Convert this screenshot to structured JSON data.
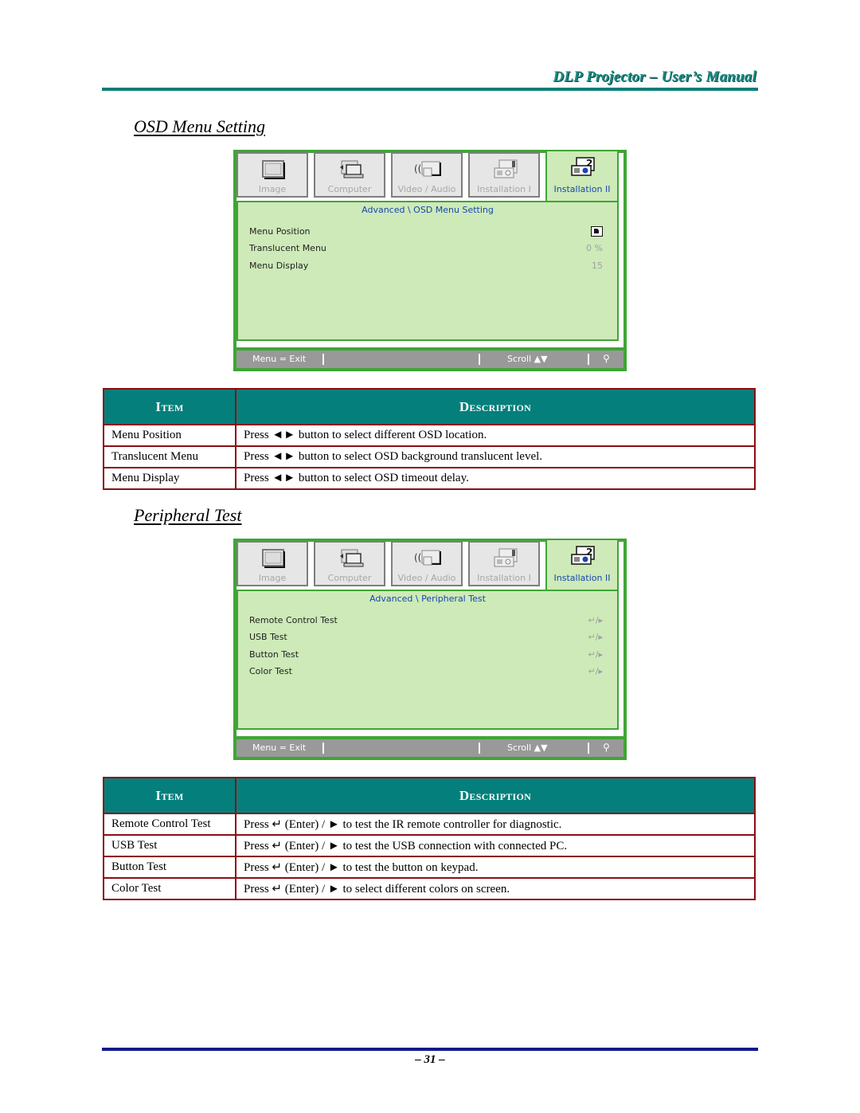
{
  "header": {
    "title": "DLP Projector – User’s Manual"
  },
  "sections": [
    {
      "title": "OSD Menu Setting",
      "osd": {
        "tabs": [
          {
            "label": "Image",
            "icon": "image-icon"
          },
          {
            "label": "Computer",
            "icon": "computer-icon"
          },
          {
            "label": "Video / Audio",
            "icon": "video-audio-icon"
          },
          {
            "label": "Installation I",
            "icon": "installation-1-icon"
          },
          {
            "label": "Installation II",
            "icon": "installation-2-icon",
            "active": true
          }
        ],
        "breadcrumb": "Advanced \\ OSD Menu Setting",
        "items": [
          {
            "label": "Menu Position",
            "value": "",
            "value_icon": "position-icon"
          },
          {
            "label": "Translucent Menu",
            "value": "0 %"
          },
          {
            "label": "Menu Display",
            "value": "15"
          }
        ],
        "footer": {
          "exit": "Menu = Exit",
          "scroll": "Scroll ▲▼",
          "bulb": "lamp-icon"
        }
      },
      "table": {
        "headers": [
          "Item",
          "Description"
        ],
        "rows": [
          [
            "Menu Position",
            "Press ◄► button to select different OSD location."
          ],
          [
            "Translucent Menu",
            "Press ◄► button to select OSD background translucent level."
          ],
          [
            "Menu Display",
            "Press ◄► button to select OSD timeout delay."
          ]
        ]
      }
    },
    {
      "title": "Peripheral Test",
      "osd": {
        "tabs": [
          {
            "label": "Image",
            "icon": "image-icon"
          },
          {
            "label": "Computer",
            "icon": "computer-icon"
          },
          {
            "label": "Video / Audio",
            "icon": "video-audio-icon"
          },
          {
            "label": "Installation I",
            "icon": "installation-1-icon"
          },
          {
            "label": "Installation II",
            "icon": "installation-2-icon",
            "active": true
          }
        ],
        "breadcrumb": "Advanced \\ Peripheral Test",
        "items": [
          {
            "label": "Remote Control Test",
            "value": "↵/▸"
          },
          {
            "label": "USB Test",
            "value": "↵/▸"
          },
          {
            "label": "Button Test",
            "value": "↵/▸"
          },
          {
            "label": "Color Test",
            "value": "↵/▸"
          }
        ],
        "footer": {
          "exit": "Menu = Exit",
          "scroll": "Scroll ▲▼",
          "bulb": "lamp-icon"
        }
      },
      "table": {
        "headers": [
          "Item",
          "Description"
        ],
        "rows": [
          [
            "Remote Control Test",
            "Press ↵ (Enter) / ► to test the IR remote controller for diagnostic."
          ],
          [
            "USB Test",
            "Press ↵ (Enter) / ► to test the USB connection with connected PC."
          ],
          [
            "Button Test",
            "Press ↵ (Enter) / ► to test the button on keypad."
          ],
          [
            "Color Test",
            "Press ↵ (Enter) / ► to select different colors on screen."
          ]
        ]
      }
    }
  ],
  "page_number": "– 31 –",
  "colors": {
    "header_teal": "#0c7f7a",
    "table_header": "#047f7b",
    "table_border": "#8a0f14",
    "osd_green": "#3fa535",
    "osd_bg": "#cdeab8",
    "osd_link": "#1846b0",
    "footer_rule": "#0c1a8c"
  }
}
